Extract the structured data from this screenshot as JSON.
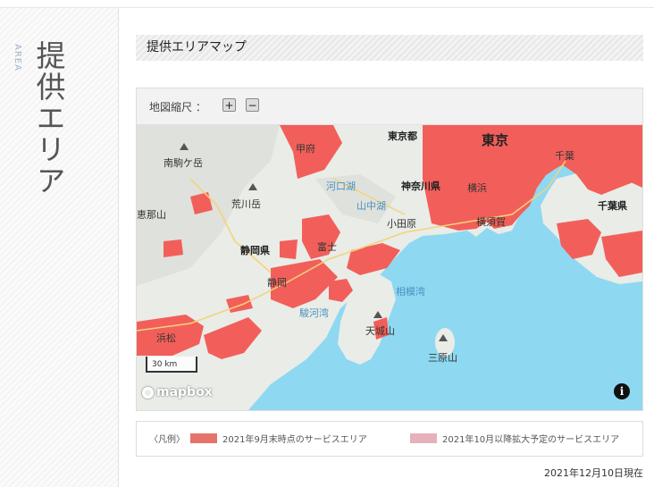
{
  "side": {
    "en": "AREA",
    "jp": "提供エリア"
  },
  "section_title": "提供エリアマップ",
  "zoom": {
    "label": "地図縮尺 ：",
    "in": "+",
    "out": "−"
  },
  "map": {
    "labels": [
      "東京都",
      "東京",
      "甲府",
      "千葉",
      "千葉県",
      "神奈川県",
      "横浜",
      "横須賀",
      "小田原",
      "河口湖",
      "山中湖",
      "荒川岳",
      "恵那山",
      "南駒ケ岳",
      "静岡県",
      "静岡",
      "富士",
      "駿河湾",
      "相模湾",
      "天城山",
      "三原山",
      "浜松"
    ],
    "scale": "30 km",
    "attribution": "mapbox",
    "info_icon": "i"
  },
  "legend": {
    "prefix": "〈凡例〉",
    "items": [
      {
        "color": "#e5736b",
        "label": "2021年9月末時点のサービスエリア"
      },
      {
        "color": "#e6b0bc",
        "label": "2021年10月以降拡大予定のサービスエリア"
      }
    ]
  },
  "date_note": "2021年12月10日現在",
  "colors": {
    "coverage": "#f25f5a",
    "sea": "#8fd8f1",
    "land": "#e9ece7"
  }
}
